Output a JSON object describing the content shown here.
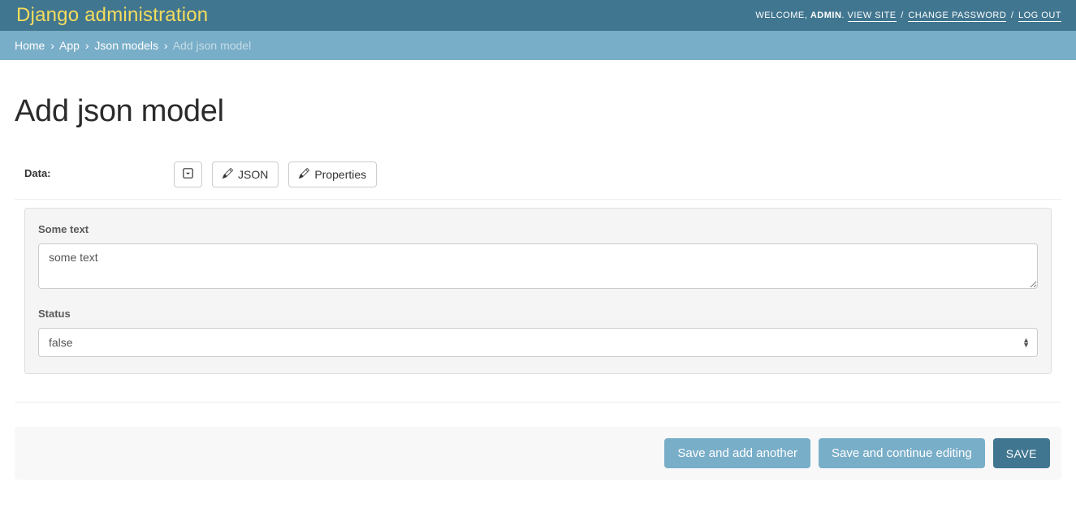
{
  "header": {
    "title": "Django administration",
    "welcome": "WELCOME, ",
    "user": "ADMIN",
    "links": {
      "view_site": "VIEW SITE",
      "change_password": "CHANGE PASSWORD",
      "logout": "LOG OUT"
    }
  },
  "breadcrumbs": {
    "home": "Home",
    "app": "App",
    "models": "Json models",
    "current": "Add json model"
  },
  "page": {
    "title": "Add json model"
  },
  "form": {
    "data_label": "Data:",
    "editor_buttons": {
      "json": "JSON",
      "properties": "Properties"
    },
    "fields": {
      "some_text": {
        "label": "Some text",
        "value": "some text"
      },
      "status": {
        "label": "Status",
        "value": "false"
      }
    }
  },
  "submit": {
    "save_add_another": "Save and add another",
    "save_continue": "Save and continue editing",
    "save": "SAVE"
  }
}
